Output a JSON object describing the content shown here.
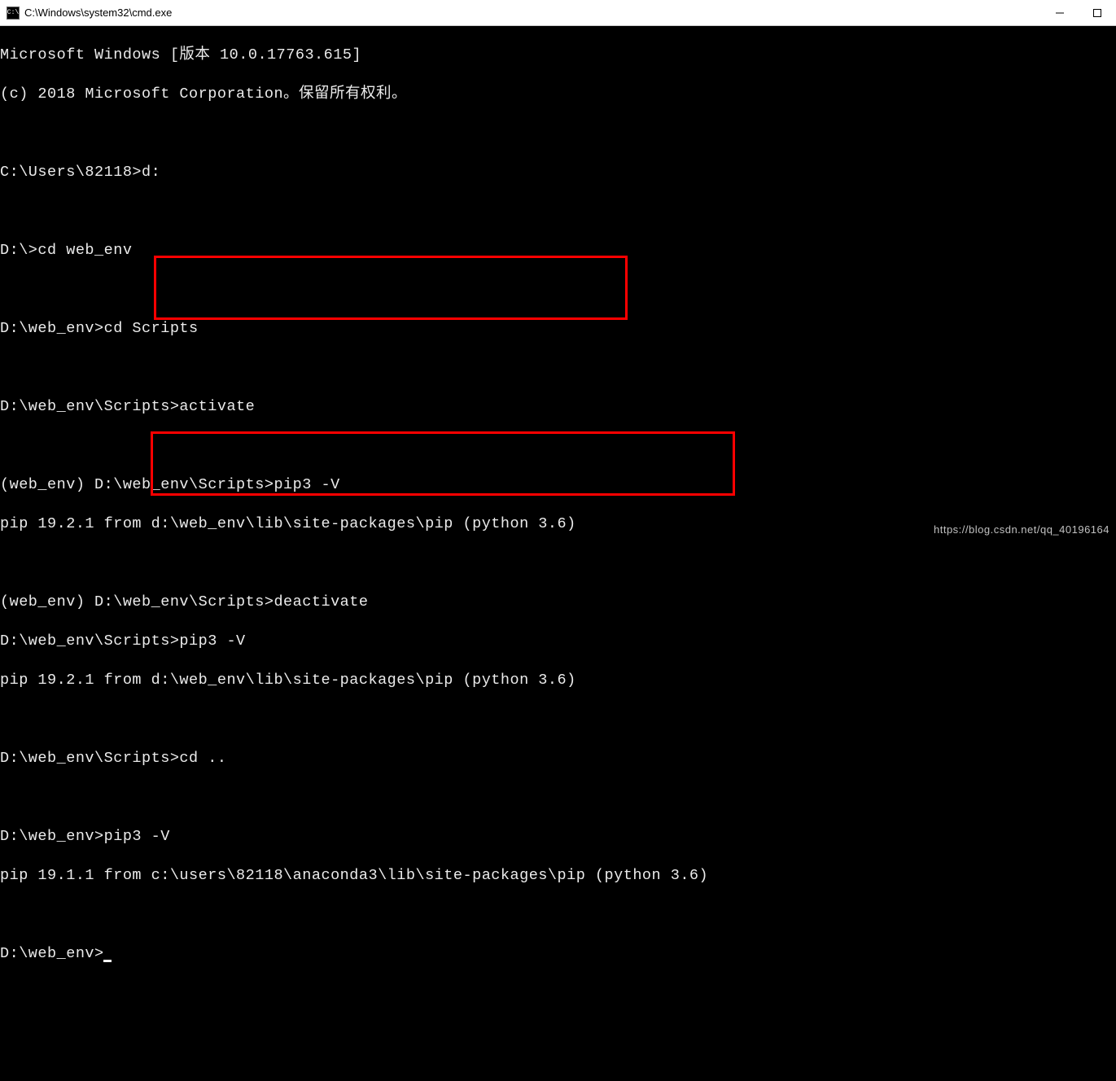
{
  "titlebar": {
    "icon_text": "C:\\",
    "title": "C:\\Windows\\system32\\cmd.exe"
  },
  "lines": {
    "l0": "Microsoft Windows [版本 10.0.17763.615]",
    "l1": "(c) 2018 Microsoft Corporation。保留所有权利。",
    "l2": "",
    "l3": "C:\\Users\\82118>d:",
    "l4": "",
    "l5": "D:\\>cd web_env",
    "l6": "",
    "l7": "D:\\web_env>cd Scripts",
    "l8": "",
    "l9": "D:\\web_env\\Scripts>activate",
    "l10": "",
    "l11": "(web_env) D:\\web_env\\Scripts>pip3 -V",
    "l12": "pip 19.2.1 from d:\\web_env\\lib\\site-packages\\pip (python 3.6)",
    "l13": "",
    "l14": "(web_env) D:\\web_env\\Scripts>deactivate",
    "l15": "D:\\web_env\\Scripts>pip3 -V",
    "l16": "pip 19.2.1 from d:\\web_env\\lib\\site-packages\\pip (python 3.6)",
    "l17": "",
    "l18": "D:\\web_env\\Scripts>cd ..",
    "l19": "",
    "l20": "D:\\web_env>pip3 -V",
    "l21": "pip 19.1.1 from c:\\users\\82118\\anaconda3\\lib\\site-packages\\pip (python 3.6)",
    "l22": "",
    "l23": "D:\\web_env>"
  },
  "watermark": "https://blog.csdn.net/qq_40196164"
}
